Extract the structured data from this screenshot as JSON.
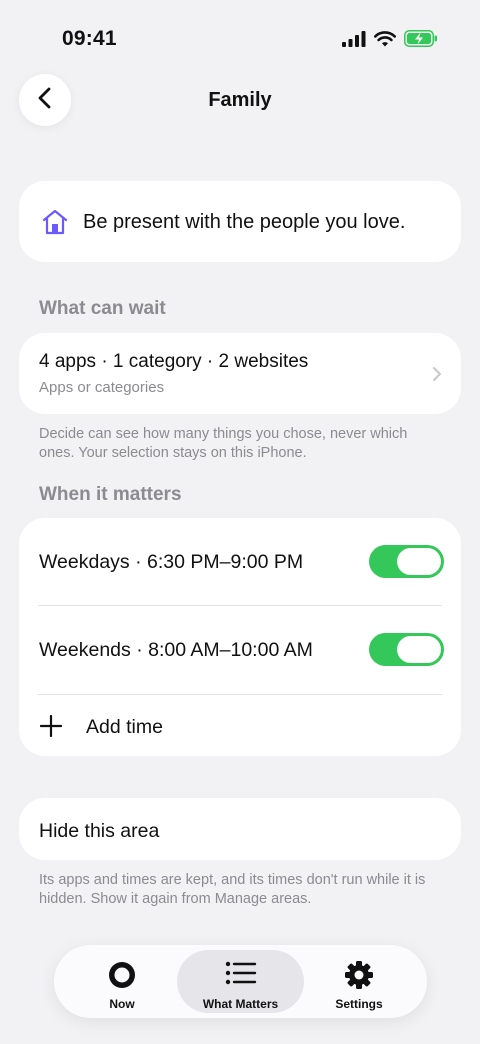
{
  "status": {
    "time": "09:41"
  },
  "nav": {
    "title": "Family"
  },
  "intent": {
    "text": "Be present with the people you love."
  },
  "what_can_wait": {
    "header": "What can wait",
    "summary": "4 apps · 1 category · 2 websites",
    "subtitle": "Apps or categories",
    "footnote": "Decide can see how many things you chose, never which ones. Your selection stays on this iPhone."
  },
  "when_it_matters": {
    "header": "When it matters",
    "rows": [
      {
        "label": "Weekdays · 6:30 PM–9:00 PM",
        "enabled": true
      },
      {
        "label": "Weekends · 8:00 AM–10:00 AM",
        "enabled": true
      }
    ],
    "add_label": "Add time"
  },
  "hide_area": {
    "label": "Hide this area",
    "footnote": "Its apps and times are kept, and its times don't run while it is hidden. Show it again from Manage areas."
  },
  "tabbar": {
    "tabs": [
      {
        "label": "Now",
        "icon": "record-circle-icon",
        "active": false
      },
      {
        "label": "What Matters",
        "icon": "list-icon",
        "active": true
      },
      {
        "label": "Settings",
        "icon": "gear-icon",
        "active": false
      }
    ]
  },
  "colors": {
    "accent": "#34c759",
    "intent_icon": "#6a5af9",
    "secondary_text": "#8b8b90"
  }
}
